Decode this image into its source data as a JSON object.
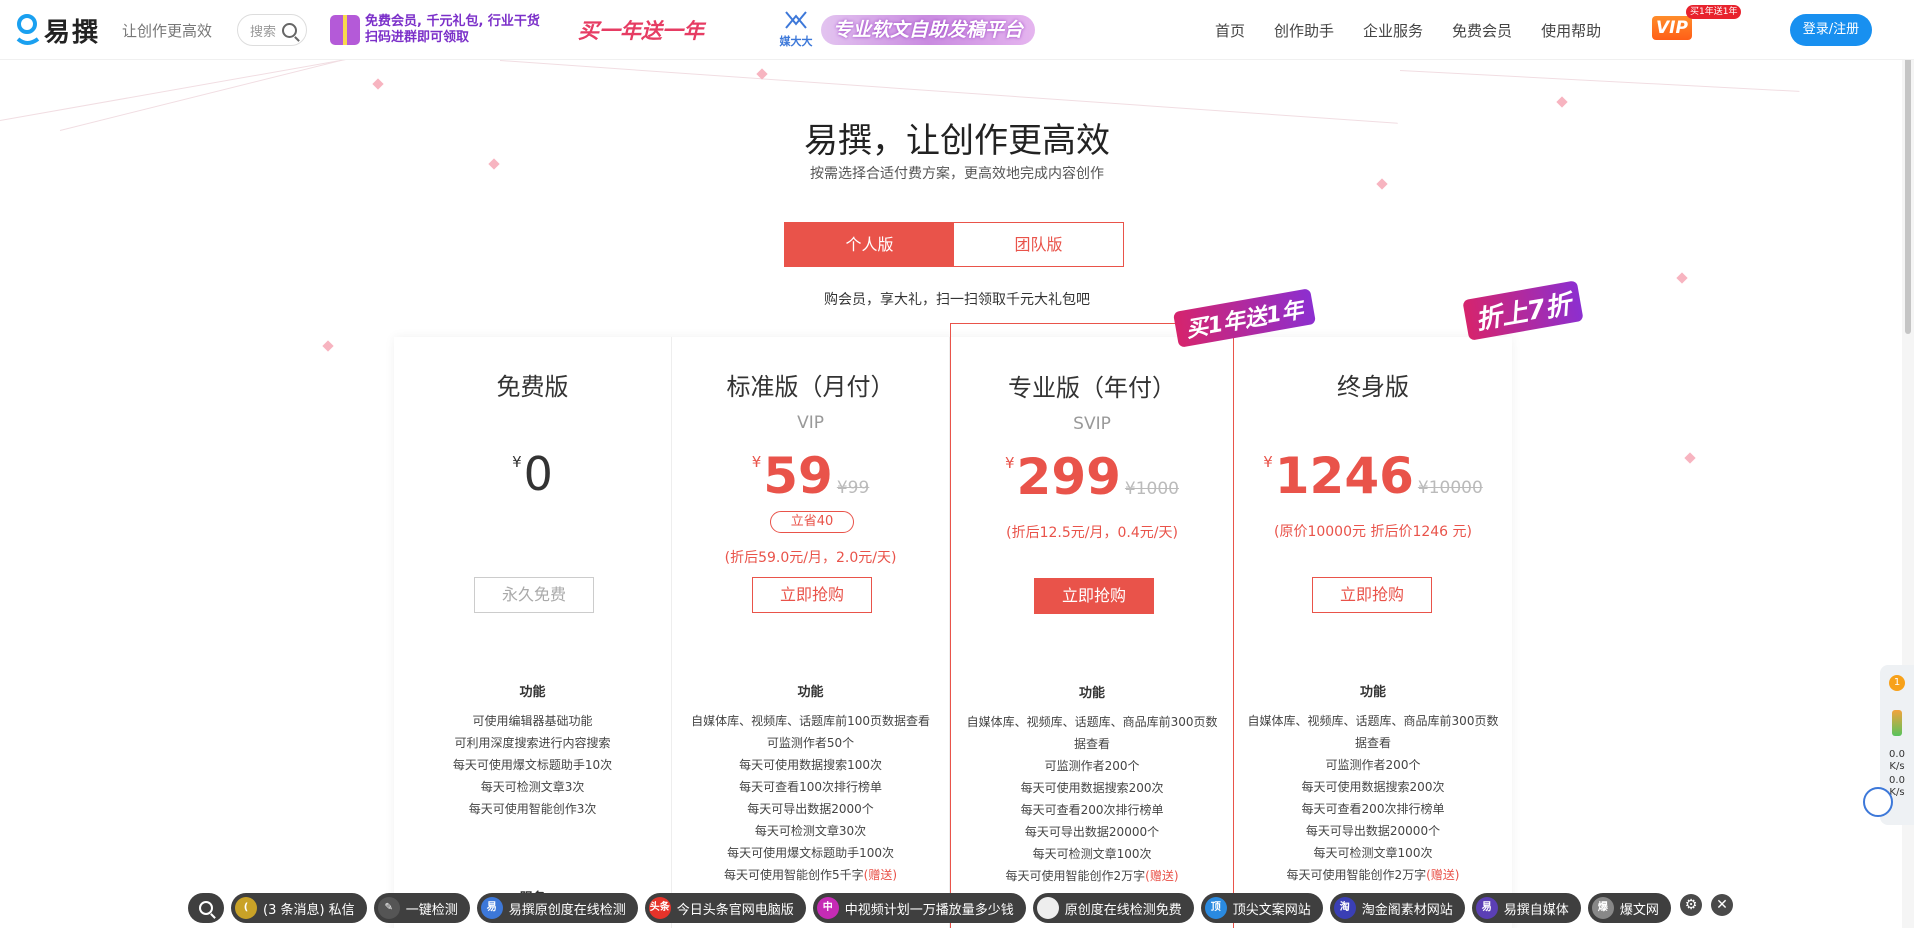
{
  "header": {
    "logo_text": "易撰",
    "slogan": "让创作更高效",
    "search_placeholder": "搜索",
    "promo1_line1": "免费会员, 千元礼包, 行业干货",
    "promo1_line2": "扫码进群即可领取",
    "promo2": "买一年送一年",
    "promo3_logo": "媒大大",
    "promo3_banner": "专业软文自助发稿平台",
    "nav": [
      "首页",
      "创作助手",
      "企业服务",
      "免费会员",
      "使用帮助"
    ],
    "vip_label": "VIP",
    "vip_tag": "买1年送1年",
    "login": "登录/注册"
  },
  "hero": {
    "title": "易撰，让创作更高效",
    "subtitle": "按需选择合适付费方案，更高效地完成内容创作"
  },
  "tabs": [
    "个人版",
    "团队版"
  ],
  "promo_line": "购会员，享大礼，扫一扫领取千元大礼包吧",
  "ribbons": [
    "买1年送1年",
    "折上7折"
  ],
  "currency": "¥",
  "plans": [
    {
      "name": "免费版",
      "level": "",
      "price": "0",
      "orig": "",
      "save": "",
      "note": "",
      "button": "永久免费",
      "feature_title": "功能",
      "features": [
        "可使用编辑器基础功能",
        "可利用深度搜索进行内容搜索",
        "每天可使用爆文标题助手10次",
        "每天可检测文章3次",
        "每天可使用智能创作3次"
      ],
      "gift": "",
      "service_title": "服务"
    },
    {
      "name": "标准版（月付）",
      "level": "VIP",
      "price": "59",
      "orig": "¥99",
      "save": "立省40",
      "note": "(折后59.0元/月，2.0元/天)",
      "button": "立即抢购",
      "feature_title": "功能",
      "features": [
        "自媒体库、视频库、话题库前100页数据查看",
        "可监测作者50个",
        "每天可使用数据搜索100次",
        "每天可查看100次排行榜单",
        "每天可导出数据2000个",
        "每天可检测文章30次",
        "每天可使用爆文标题助手100次",
        "每天可使用智能创作5千字"
      ],
      "gift": "(赠送)",
      "service_title": ""
    },
    {
      "name": "专业版（年付）",
      "level": "SVIP",
      "price": "299",
      "orig": "¥1000",
      "save": "",
      "note": "(折后12.5元/月，0.4元/天)",
      "button": "立即抢购",
      "feature_title": "功能",
      "features": [
        "自媒体库、视频库、话题库、商品库前300页数据查看",
        "可监测作者200个",
        "每天可使用数据搜索200次",
        "每天可查看200次排行榜单",
        "每天可导出数据20000个",
        "每天可检测文章100次",
        "每天可使用智能创作2万字"
      ],
      "gift": "(赠送)",
      "service_title": ""
    },
    {
      "name": "终身版",
      "level": "",
      "price": "1246",
      "orig": "¥10000",
      "save": "",
      "note": "(原价10000元 折后价1246 元)",
      "button": "立即抢购",
      "feature_title": "功能",
      "features": [
        "自媒体库、视频库、话题库、商品库前300页数据查看",
        "可监测作者200个",
        "每天可使用数据搜索200次",
        "每天可查看200次排行榜单",
        "每天可导出数据20000个",
        "每天可检测文章100次",
        "每天可使用智能创作2万字"
      ],
      "gift": "(赠送)",
      "service_title": ""
    }
  ],
  "side_widget": {
    "badge": "1",
    "speed_up": "0.0",
    "speed_down": "0.0",
    "unit": "K/s"
  },
  "taskbar": [
    {
      "icon": "(",
      "label": "(3 条消息) 私信",
      "color": "#c9a227"
    },
    {
      "icon": "✎",
      "label": "一键检测",
      "color": "#555"
    },
    {
      "icon": "易",
      "label": "易撰原创度在线检测",
      "color": "#3d78d9"
    },
    {
      "icon": "头条",
      "label": "今日头条官网电脑版",
      "color": "#e6332a"
    },
    {
      "icon": "中",
      "label": "中视频计划一万播放量多少钱",
      "color": "#c62bb5"
    },
    {
      "icon": "",
      "label": "原创度在线检测免费",
      "color": "#eee"
    },
    {
      "icon": "顶",
      "label": "顶尖文案网站",
      "color": "#2a8ae0"
    },
    {
      "icon": "淘",
      "label": "淘金阁素材网站",
      "color": "#3a3fb5"
    },
    {
      "icon": "易",
      "label": "易撰自媒体",
      "color": "#5b3fb5"
    },
    {
      "icon": "爆",
      "label": "爆文网",
      "color": "#888"
    }
  ],
  "colors": {
    "accent": "#e9534a",
    "login": "#1890f0",
    "vip": "#ff6b1a"
  }
}
